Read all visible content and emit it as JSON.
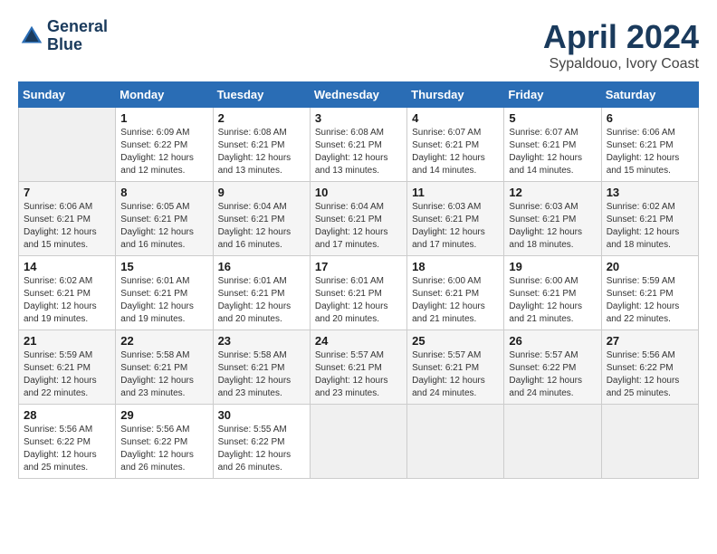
{
  "header": {
    "logo_line1": "General",
    "logo_line2": "Blue",
    "month_title": "April 2024",
    "subtitle": "Sypaldouo, Ivory Coast"
  },
  "days_of_week": [
    "Sunday",
    "Monday",
    "Tuesday",
    "Wednesday",
    "Thursday",
    "Friday",
    "Saturday"
  ],
  "weeks": [
    [
      {
        "day": "",
        "info": ""
      },
      {
        "day": "1",
        "info": "Sunrise: 6:09 AM\nSunset: 6:22 PM\nDaylight: 12 hours and 12 minutes."
      },
      {
        "day": "2",
        "info": "Sunrise: 6:08 AM\nSunset: 6:21 PM\nDaylight: 12 hours and 13 minutes."
      },
      {
        "day": "3",
        "info": "Sunrise: 6:08 AM\nSunset: 6:21 PM\nDaylight: 12 hours and 13 minutes."
      },
      {
        "day": "4",
        "info": "Sunrise: 6:07 AM\nSunset: 6:21 PM\nDaylight: 12 hours and 14 minutes."
      },
      {
        "day": "5",
        "info": "Sunrise: 6:07 AM\nSunset: 6:21 PM\nDaylight: 12 hours and 14 minutes."
      },
      {
        "day": "6",
        "info": "Sunrise: 6:06 AM\nSunset: 6:21 PM\nDaylight: 12 hours and 15 minutes."
      }
    ],
    [
      {
        "day": "7",
        "info": "Sunrise: 6:06 AM\nSunset: 6:21 PM\nDaylight: 12 hours and 15 minutes."
      },
      {
        "day": "8",
        "info": "Sunrise: 6:05 AM\nSunset: 6:21 PM\nDaylight: 12 hours and 16 minutes."
      },
      {
        "day": "9",
        "info": "Sunrise: 6:04 AM\nSunset: 6:21 PM\nDaylight: 12 hours and 16 minutes."
      },
      {
        "day": "10",
        "info": "Sunrise: 6:04 AM\nSunset: 6:21 PM\nDaylight: 12 hours and 17 minutes."
      },
      {
        "day": "11",
        "info": "Sunrise: 6:03 AM\nSunset: 6:21 PM\nDaylight: 12 hours and 17 minutes."
      },
      {
        "day": "12",
        "info": "Sunrise: 6:03 AM\nSunset: 6:21 PM\nDaylight: 12 hours and 18 minutes."
      },
      {
        "day": "13",
        "info": "Sunrise: 6:02 AM\nSunset: 6:21 PM\nDaylight: 12 hours and 18 minutes."
      }
    ],
    [
      {
        "day": "14",
        "info": "Sunrise: 6:02 AM\nSunset: 6:21 PM\nDaylight: 12 hours and 19 minutes."
      },
      {
        "day": "15",
        "info": "Sunrise: 6:01 AM\nSunset: 6:21 PM\nDaylight: 12 hours and 19 minutes."
      },
      {
        "day": "16",
        "info": "Sunrise: 6:01 AM\nSunset: 6:21 PM\nDaylight: 12 hours and 20 minutes."
      },
      {
        "day": "17",
        "info": "Sunrise: 6:01 AM\nSunset: 6:21 PM\nDaylight: 12 hours and 20 minutes."
      },
      {
        "day": "18",
        "info": "Sunrise: 6:00 AM\nSunset: 6:21 PM\nDaylight: 12 hours and 21 minutes."
      },
      {
        "day": "19",
        "info": "Sunrise: 6:00 AM\nSunset: 6:21 PM\nDaylight: 12 hours and 21 minutes."
      },
      {
        "day": "20",
        "info": "Sunrise: 5:59 AM\nSunset: 6:21 PM\nDaylight: 12 hours and 22 minutes."
      }
    ],
    [
      {
        "day": "21",
        "info": "Sunrise: 5:59 AM\nSunset: 6:21 PM\nDaylight: 12 hours and 22 minutes."
      },
      {
        "day": "22",
        "info": "Sunrise: 5:58 AM\nSunset: 6:21 PM\nDaylight: 12 hours and 23 minutes."
      },
      {
        "day": "23",
        "info": "Sunrise: 5:58 AM\nSunset: 6:21 PM\nDaylight: 12 hours and 23 minutes."
      },
      {
        "day": "24",
        "info": "Sunrise: 5:57 AM\nSunset: 6:21 PM\nDaylight: 12 hours and 23 minutes."
      },
      {
        "day": "25",
        "info": "Sunrise: 5:57 AM\nSunset: 6:21 PM\nDaylight: 12 hours and 24 minutes."
      },
      {
        "day": "26",
        "info": "Sunrise: 5:57 AM\nSunset: 6:22 PM\nDaylight: 12 hours and 24 minutes."
      },
      {
        "day": "27",
        "info": "Sunrise: 5:56 AM\nSunset: 6:22 PM\nDaylight: 12 hours and 25 minutes."
      }
    ],
    [
      {
        "day": "28",
        "info": "Sunrise: 5:56 AM\nSunset: 6:22 PM\nDaylight: 12 hours and 25 minutes."
      },
      {
        "day": "29",
        "info": "Sunrise: 5:56 AM\nSunset: 6:22 PM\nDaylight: 12 hours and 26 minutes."
      },
      {
        "day": "30",
        "info": "Sunrise: 5:55 AM\nSunset: 6:22 PM\nDaylight: 12 hours and 26 minutes."
      },
      {
        "day": "",
        "info": ""
      },
      {
        "day": "",
        "info": ""
      },
      {
        "day": "",
        "info": ""
      },
      {
        "day": "",
        "info": ""
      }
    ]
  ]
}
